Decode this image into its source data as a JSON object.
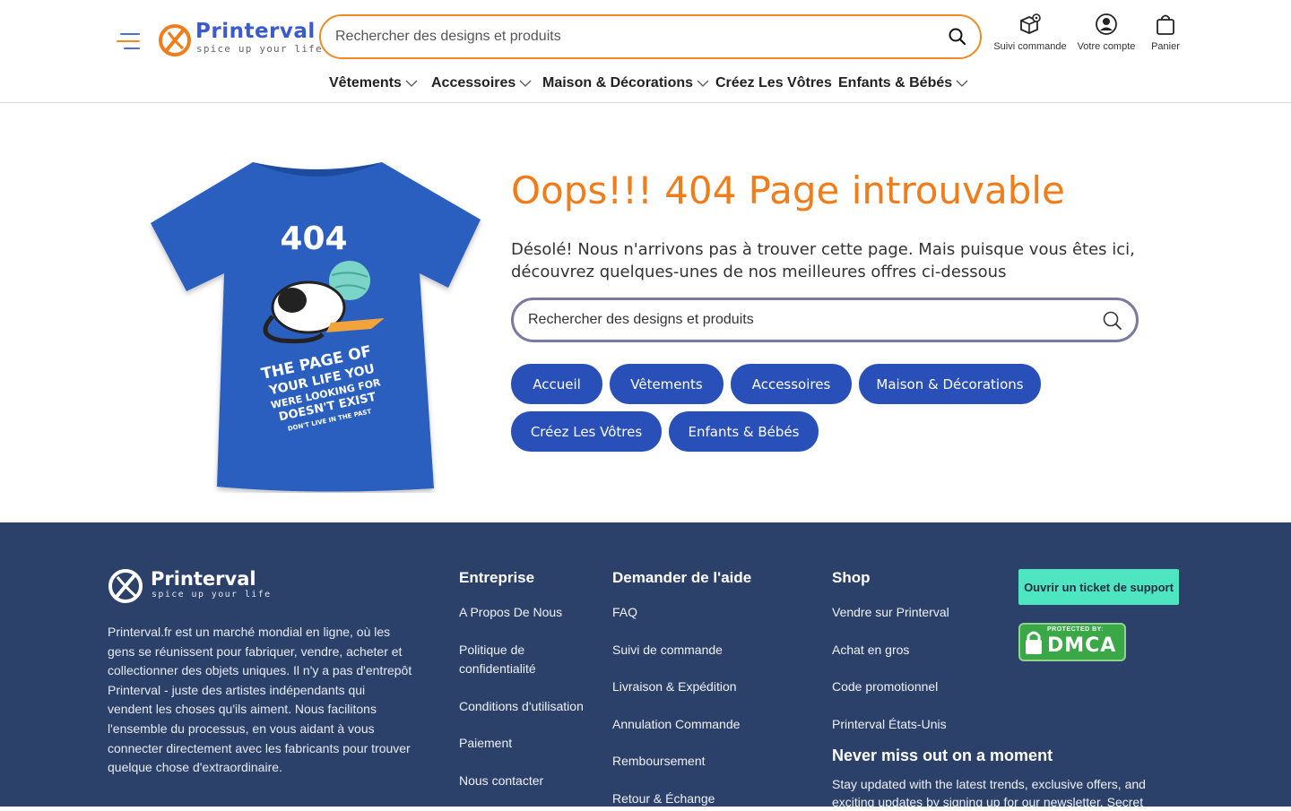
{
  "header": {
    "logo_name": "Printerval",
    "logo_tagline": "spice up your life",
    "search_placeholder": "Rechercher des designs et produits",
    "icons": [
      {
        "icon": "box-location-icon",
        "label": "Suivi commande"
      },
      {
        "icon": "user-circle-icon",
        "label": "Votre compte"
      },
      {
        "icon": "shopping-bag-icon",
        "label": "Panier"
      }
    ],
    "nav": [
      {
        "label": "Vêtements",
        "dropdown": true
      },
      {
        "label": "Accessoires",
        "dropdown": true
      },
      {
        "label": "Maison & Décorations",
        "dropdown": true
      },
      {
        "label": "Créez Les Vôtres",
        "dropdown": false
      },
      {
        "label": "Enfants & Bébés",
        "dropdown": true
      }
    ]
  },
  "main": {
    "shirt": {
      "big": "404",
      "line1": "THE PAGE OF",
      "line2": "YOUR LIFE YOU",
      "line3": "WERE LOOKING FOR",
      "line4": "DOESN'T EXIST",
      "line5": "DON'T LIVE IN THE PAST"
    },
    "title": "Oops!!! 404 Page introuvable",
    "description": "Désolé! Nous n'arrivons pas à trouver cette page. Mais puisque vous êtes ici, découvrez quelques-unes de nos meilleures offres ci-dessous",
    "search_placeholder": "Rechercher des designs et produits",
    "pills": [
      "Accueil",
      "Vêtements",
      "Accessoires",
      "Maison & Décorations",
      "Créez Les Vôtres",
      "Enfants & Bébés"
    ]
  },
  "footer": {
    "logo_name": "Printerval",
    "logo_tagline": "spice up your life",
    "description": "Printerval.fr est un marché mondial en ligne, où les gens se réunissent pour fabriquer, vendre, acheter et collectionner des objets uniques. Il n'y a pas d'entrepôt Printerval - juste des artistes indépendants qui vendent les choses qu'ils aiment. Nous facilitons l'ensemble du processus, en vous aidant à vous connecter directement avec les fabricants pour trouver quelque chose d'extraordinaire.",
    "col1": {
      "title": "Entreprise",
      "links": [
        "A Propos De Nous",
        "Politique de confidentialité",
        "Conditions d'utilisation",
        "Paiement",
        "Nous contacter"
      ]
    },
    "col2": {
      "title": "Demander de l'aide",
      "links": [
        "FAQ",
        "Suivi de commande",
        "Livraison & Expédition",
        "Annulation Commande",
        "Remboursement",
        "Retour & Échange"
      ]
    },
    "col3": {
      "title": "Shop",
      "links": [
        "Vendre sur Printerval",
        "Achat en gros",
        "Code promotionnel",
        "Printerval États-Unis"
      ]
    },
    "ticket_label": "Ouvrir un ticket de support",
    "dmca_top": "PROTECTED BY:",
    "dmca_main": "DMCA",
    "newsletter_title": "Never miss out on a moment",
    "newsletter_text": "Stay updated with the latest trends, exclusive offers, and exciting updates by signing up for our newsletter. Secret"
  },
  "colors": {
    "accent_orange": "#f07d1a",
    "brand_blue": "#2950b8",
    "footer_bg": "#2c4169",
    "ticket_bg": "#4ee6c0"
  }
}
